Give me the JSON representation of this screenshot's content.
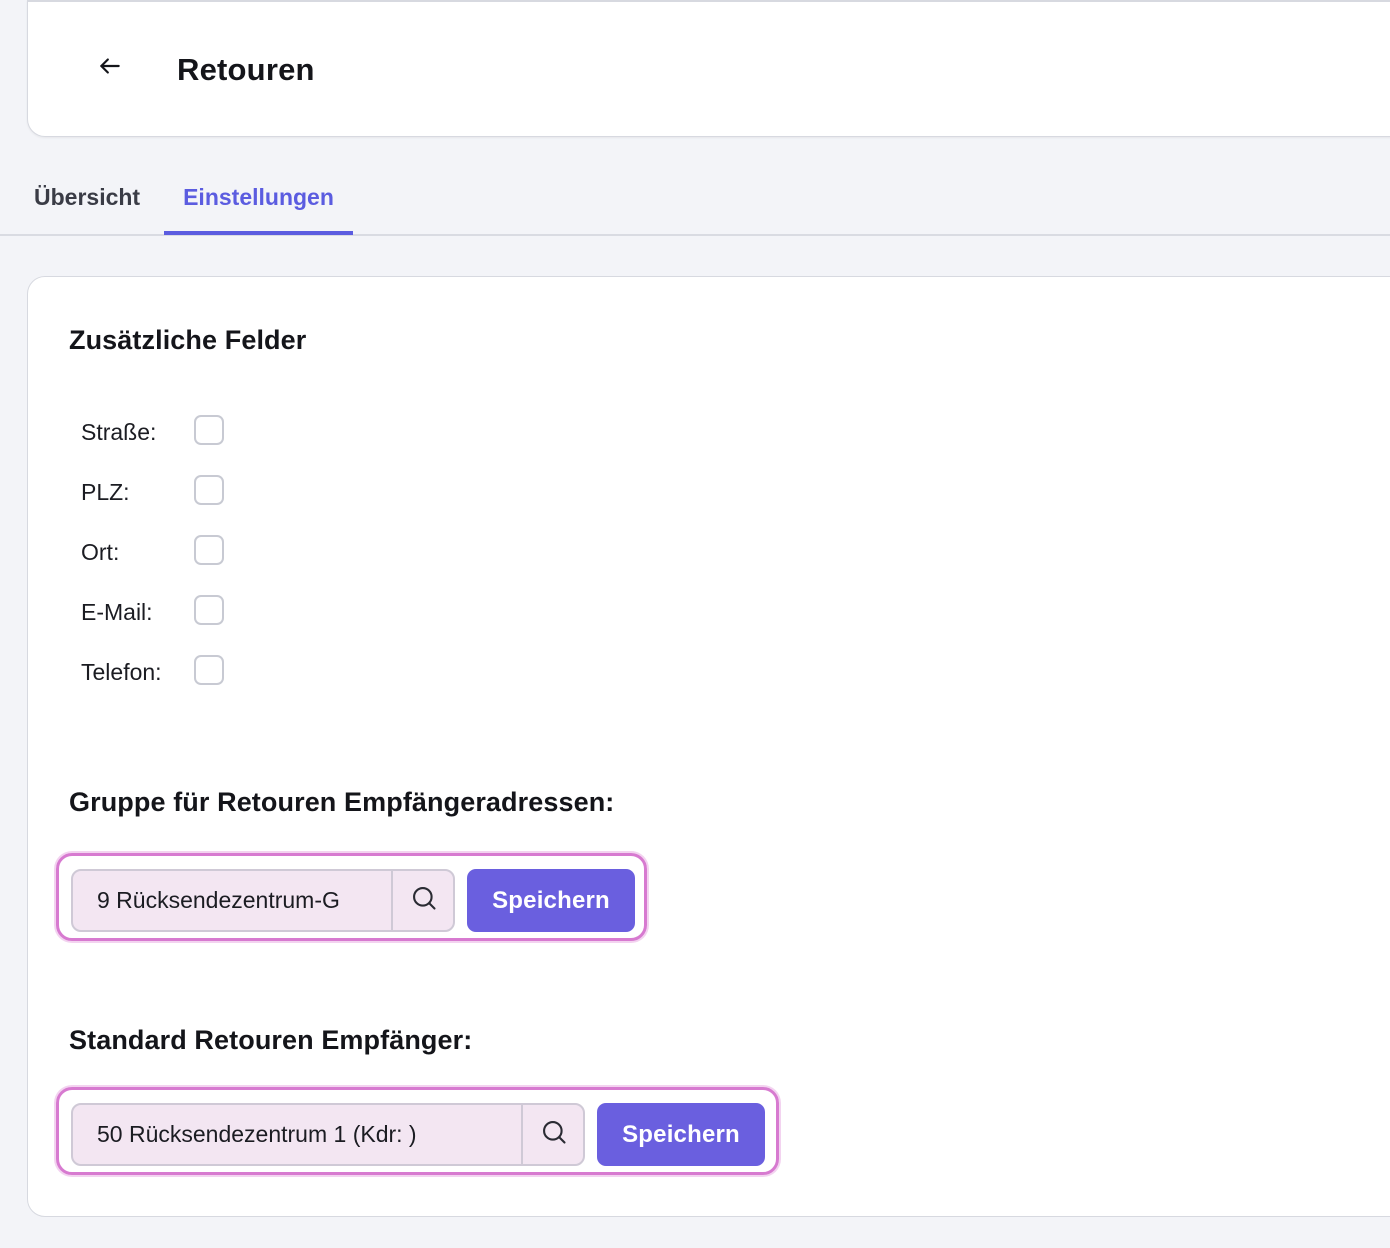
{
  "header": {
    "back_icon": "arrow-left-icon",
    "title": "Retouren"
  },
  "tabs": [
    {
      "label": "Übersicht",
      "active": false
    },
    {
      "label": "Einstellungen",
      "active": true
    }
  ],
  "colors": {
    "accent": "#5b5ce0",
    "button": "#6a5fdf",
    "highlight_border": "#d77ad0",
    "input_bg": "#f3e6f2"
  },
  "settings": {
    "additional_fields": {
      "title": "Zusätzliche Felder",
      "fields": [
        {
          "label": "Straße:",
          "checked": false
        },
        {
          "label": "PLZ:",
          "checked": false
        },
        {
          "label": "Ort:",
          "checked": false
        },
        {
          "label": "E-Mail:",
          "checked": false
        },
        {
          "label": "Telefon:",
          "checked": false
        }
      ]
    },
    "recipient_group": {
      "title": "Gruppe für Retouren Empfängeradressen:",
      "value": "9 Rücksendezentrum-G",
      "search_icon": "search-icon",
      "save_label": "Speichern"
    },
    "default_recipient": {
      "title": "Standard Retouren Empfänger:",
      "value": "50 Rücksendezentrum 1 (Kdr: )",
      "search_icon": "search-icon",
      "save_label": "Speichern"
    }
  }
}
